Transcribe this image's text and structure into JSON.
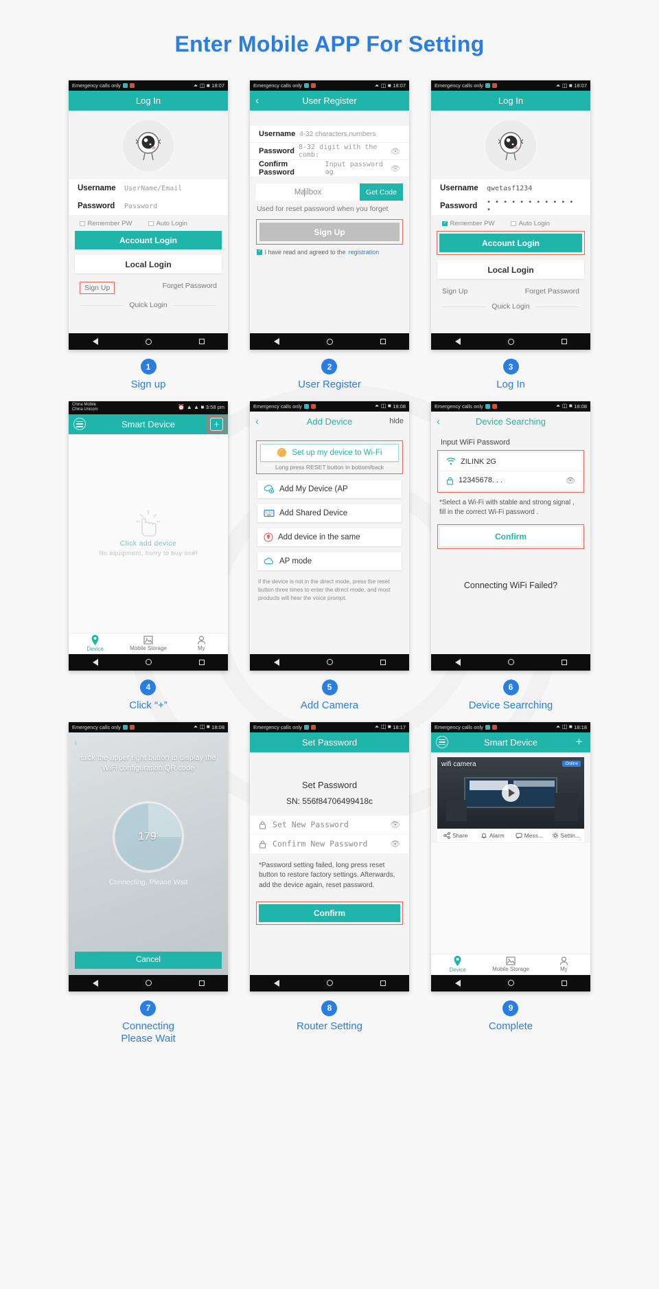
{
  "page": {
    "title": "Enter Mobile APP For Setting",
    "accent": "#2a7de1",
    "teal": "#1fb5ab",
    "highlight": "#e8655a"
  },
  "steps": [
    {
      "number": "1",
      "caption": "Sign up",
      "status": {
        "carrier": "Emergency calls only",
        "time": "18:07"
      },
      "appbar": {
        "title": "Log In"
      },
      "fields": [
        {
          "label": "Username",
          "value": "UserName/Email"
        },
        {
          "label": "Password",
          "value": "Password"
        }
      ],
      "checks": [
        {
          "label": "Remember PW",
          "checked": false
        },
        {
          "label": "Auto Login",
          "checked": false
        }
      ],
      "buttons": {
        "primary": "Account Login",
        "ghost": "Local Login"
      },
      "links": {
        "signup": "Sign Up",
        "forget": "Forget Password",
        "quick": "Quick Login"
      }
    },
    {
      "number": "2",
      "caption": "User Register",
      "status": {
        "carrier": "Emergency calls only",
        "time": "18:07"
      },
      "appbar": {
        "title": "User Register",
        "back": "back-arrow"
      },
      "fields": [
        {
          "label": "Username",
          "value": "4-32 characters,numbers"
        },
        {
          "label": "Password",
          "value": "8-32 digit with the comb:"
        },
        {
          "label": "Confirm Password",
          "value": "Input password ag"
        }
      ],
      "mailbox": {
        "placeholder": "Mailbox",
        "get_code": "Get Code"
      },
      "hint": "Used for reset password when you forget",
      "signup_button": "Sign Up",
      "agree": {
        "text": "I have read and agreed to the",
        "link": "registration",
        "checked": true
      }
    },
    {
      "number": "3",
      "caption": "Log In",
      "status": {
        "carrier": "Emergency calls only",
        "time": "18:07"
      },
      "appbar": {
        "title": "Log In"
      },
      "fields": [
        {
          "label": "Username",
          "value": "qwetasf1234"
        },
        {
          "label": "Password",
          "value": "• • • • • • • • • • • •"
        }
      ],
      "checks": [
        {
          "label": "Remember PW",
          "checked": true
        },
        {
          "label": "Auto Login",
          "checked": false
        }
      ],
      "buttons": {
        "primary": "Account Login",
        "ghost": "Local Login"
      },
      "links": {
        "signup": "Sign Up",
        "forget": "Forget Password",
        "quick": "Quick Login"
      }
    },
    {
      "number": "4",
      "caption": "Click “+”",
      "status": {
        "carrier_line1": "China Mobile",
        "carrier_line2": "China Unicom",
        "time": "3:58 pm"
      },
      "appbar": {
        "title": "Smart Device"
      },
      "empty": {
        "line1": "Click add device",
        "line2": "No equipment, hurry to buy one!"
      },
      "tabs": [
        {
          "label": "Device",
          "active": true
        },
        {
          "label": "Mobile Storage",
          "active": false
        },
        {
          "label": "My",
          "active": false
        }
      ]
    },
    {
      "number": "5",
      "caption": "Add Camera",
      "status": {
        "carrier": "Emergency calls only",
        "time": "18:08"
      },
      "appbar": {
        "title": "Add Device",
        "right": "hide"
      },
      "primary_item": {
        "label": "Set up my device to Wi-Fi",
        "sub": "Long press RESET button in bottom/back"
      },
      "items": [
        {
          "label": "Add My Device (AP",
          "icon": "cloud-add-icon"
        },
        {
          "label": "Add Shared Device",
          "icon": "keyboard-icon"
        },
        {
          "label": "Add device in the same",
          "icon": "location-icon"
        },
        {
          "label": "AP mode",
          "icon": "cloud-icon"
        }
      ],
      "note": "if the device is not in the direct mode, press the reset button three times to enter the direct mode, and most products will hear the voice prompt."
    },
    {
      "number": "6",
      "caption": "Device Searrching",
      "status": {
        "carrier": "Emergency calls only",
        "time": "18:08"
      },
      "appbar": {
        "title": "Device Searching"
      },
      "label": "Input WiFi Password",
      "wifi": {
        "ssid": "ZILINK 2G",
        "password": "12345678. . ."
      },
      "warning": "*Select a Wi-Fi with stable and strong signal , fill in the correct Wi-Fi password .",
      "confirm": "Confirm",
      "failed": "Connecting WiFi Failed?"
    },
    {
      "number": "7",
      "caption": "Connecting\nPlease Wait",
      "status": {
        "carrier": "Emergency calls only",
        "time": "18:08"
      },
      "tip": "click the upper right button to display the WiFi configuration QR code",
      "degrees": "179'",
      "waiting": "Connecting, Please Wait",
      "cancel": "Cancel"
    },
    {
      "number": "8",
      "caption": "Router Setting",
      "status": {
        "carrier": "Emergency calls only",
        "time": "18:17"
      },
      "appbar": {
        "title": "Set Password"
      },
      "heading": "Set Password",
      "sn": "SN: 556f84706499418c",
      "fields": [
        {
          "label": "Set New Password"
        },
        {
          "label": "Confirm New Password"
        }
      ],
      "note": "*Password setting failed, long press reset button to restore factory settings. Afterwards, add the device again, reset password.",
      "confirm": "Confirm"
    },
    {
      "number": "9",
      "caption": "Complete",
      "status": {
        "carrier": "Emergency calls only",
        "time": "18:18"
      },
      "appbar": {
        "title": "Smart Device"
      },
      "camera": {
        "name": "wifi camera",
        "badge": "Online"
      },
      "actions": [
        {
          "label": "Share",
          "icon": "share-icon"
        },
        {
          "label": "Alarm",
          "icon": "bell-icon"
        },
        {
          "label": "Mess...",
          "icon": "message-icon"
        },
        {
          "label": "Settin...",
          "icon": "gear-icon"
        }
      ],
      "tabs": [
        {
          "label": "Device",
          "active": true
        },
        {
          "label": "Mobile Storage",
          "active": false
        },
        {
          "label": "My",
          "active": false
        }
      ]
    }
  ]
}
